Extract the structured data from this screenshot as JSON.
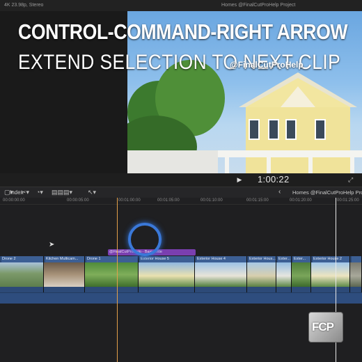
{
  "viewer": {
    "format": "4K 23.98p, Stereo",
    "project": "Homes @FinalCutProHelp Project",
    "timecode": "1:00:22"
  },
  "overlay": {
    "title": "CONTROL-COMMAND-RIGHT ARROW",
    "subtitle": "EXTEND SELECTION TO NEXT CLIP",
    "watermark": "@FinalCutProHelp"
  },
  "toolbar": {
    "index_label": "Index",
    "project_name": "Homes @FinalCutProHelp Project"
  },
  "ruler": {
    "ticks": [
      "00:00:00:00",
      "00:00:05:00",
      "00:01:00:00",
      "00:01:05:00",
      "00:01:10:00",
      "00:01:15:00",
      "00:01:20:00",
      "00:01:25:00"
    ]
  },
  "timeline": {
    "title_clip": "@FinalCutProHelp - Basic Title",
    "clips": [
      "Drone 2",
      "Kitchen Multicam...",
      "Drone 1",
      "Exterior House 5",
      "Exterior House 4",
      "Exterior Hous...",
      "Exter...",
      "Exter...",
      "Exterior House 2",
      ""
    ]
  },
  "logo": {
    "text": "FCP"
  }
}
